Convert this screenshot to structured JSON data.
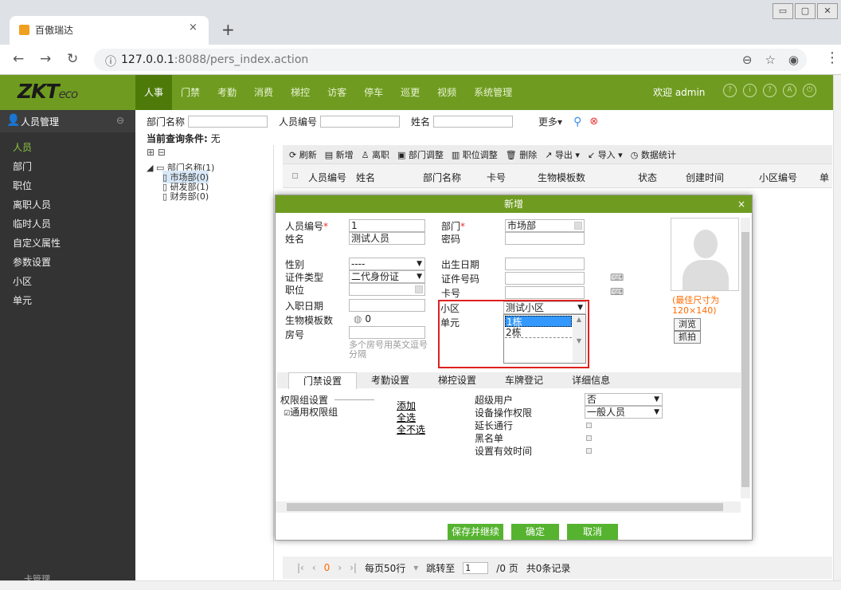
{
  "browser": {
    "tab_title": "百傲瑞达",
    "tab_close": "×",
    "new_tab": "+",
    "url_host": "127.0.0.1",
    "url_rest": ":8088/pers_index.action",
    "info_icon": "ⓘ"
  },
  "app": {
    "logo_main": "ZKT",
    "logo_sub": "eco",
    "nav": [
      "人事",
      "门禁",
      "考勤",
      "消费",
      "梯控",
      "访客",
      "停车",
      "巡更",
      "视频",
      "系统管理"
    ],
    "welcome": "欢迎 admin",
    "header_icons": [
      "?",
      "i",
      "?",
      "A",
      "⏻"
    ]
  },
  "sidebar": {
    "title": "人员管理",
    "items": [
      "人员",
      "部门",
      "职位",
      "离职人员",
      "临时人员",
      "自定义属性",
      "参数设置",
      "小区",
      "单元"
    ],
    "footer": "卡管理"
  },
  "filter": {
    "dept_label": "部门名称",
    "pin_label": "人员编号",
    "name_label": "姓名",
    "more": "更多▾",
    "current_cond_label": "当前查询条件:",
    "current_cond_value": "无"
  },
  "tree": {
    "root": "部门名称(1)",
    "children": [
      "市场部(0)",
      "研发部(1)",
      "财务部(0)"
    ]
  },
  "toolbar": [
    "刷新",
    "新增",
    "离职",
    "部门调整",
    "职位调整",
    "删除",
    "导出 ▾",
    "导入 ▾",
    "数据统计"
  ],
  "grid_headers": [
    "人员编号",
    "姓名",
    "部门名称",
    "卡号",
    "生物模板数",
    "状态",
    "创建时间",
    "小区编号",
    "单"
  ],
  "pager": {
    "per_page": "每页50行",
    "jump_to": "跳转至",
    "page_value": "1",
    "page_suffix": "/0 页",
    "total": "共0条记录",
    "current_page": "0"
  },
  "modal": {
    "title": "新增",
    "close": "×",
    "fields": {
      "pin_label": "人员编号",
      "pin_value": "1",
      "name_label": "姓名",
      "name_value": "测试人员",
      "gender_label": "性别",
      "gender_value": "----",
      "idtype_label": "证件类型",
      "idtype_value": "二代身份证",
      "position_label": "职位",
      "hire_label": "入职日期",
      "bio_label": "生物模板数",
      "bio_value": "0",
      "room_label": "房号",
      "room_hint": "多个房号用英文逗号分隔",
      "dept_label": "部门",
      "dept_value": "市场部",
      "password_label": "密码",
      "birth_label": "出生日期",
      "idno_label": "证件号码",
      "card_label": "卡号",
      "community_label": "小区",
      "community_value": "测试小区",
      "unit_label": "单元"
    },
    "unit_options": [
      "1栋",
      "2栋"
    ],
    "unit_selected": "1栋",
    "photo_hint": "(最佳尺寸为120×140)",
    "browse": "浏览",
    "capture": "抓拍",
    "tabs": [
      "门禁设置",
      "考勤设置",
      "梯控设置",
      "车牌登记",
      "详细信息"
    ],
    "access": {
      "group_legend": "权限组设置",
      "group_item": "通用权限组",
      "add": "添加",
      "select_all": "全选",
      "select_none": "全不选",
      "super_label": "超级用户",
      "super_value": "否",
      "op_label": "设备操作权限",
      "op_value": "一般人员",
      "delay_label": "延长通行",
      "blacklist_label": "黑名单",
      "validtime_label": "设置有效时间"
    },
    "buttons": {
      "save_continue": "保存并继续",
      "ok": "确定",
      "cancel": "取消"
    }
  }
}
